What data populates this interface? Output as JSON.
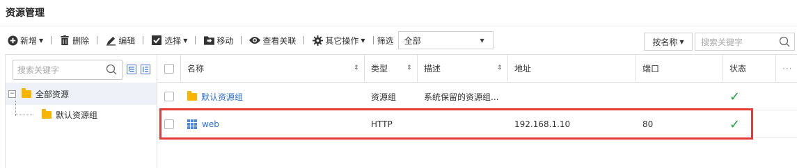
{
  "page": {
    "title": "资源管理"
  },
  "toolbar": {
    "add": "新增",
    "delete": "删除",
    "edit": "编辑",
    "select": "选择",
    "move": "移动",
    "view_link": "查看关联",
    "other_ops": "其它操作",
    "filter_label": "筛选",
    "filter_value": "全部",
    "sort_label": "按名称",
    "search_placeholder": "搜索关键字"
  },
  "tree": {
    "search_placeholder": "搜索关键字",
    "nodes": [
      {
        "label": "全部资源"
      },
      {
        "label": "默认资源组"
      }
    ]
  },
  "table": {
    "columns": [
      "名称",
      "类型",
      "描述",
      "地址",
      "端口",
      "状态"
    ],
    "more": "···",
    "rows": [
      {
        "name": "默认资源组",
        "type": "资源组",
        "desc": "系统保留的资源组...",
        "address": "",
        "port": "",
        "status": "✓"
      },
      {
        "name": "web",
        "type": "HTTP",
        "desc": "",
        "address": "192.168.1.10",
        "port": "80",
        "status": "✓"
      }
    ]
  },
  "colors": {
    "link": "#2a6fd6",
    "ok": "#1aa33a",
    "highlight": "#e53935",
    "folder": "#f7b500"
  }
}
